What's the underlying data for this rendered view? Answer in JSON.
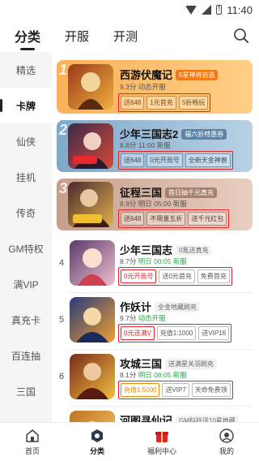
{
  "status": {
    "time": "11:40"
  },
  "top_tabs": [
    {
      "label": "分类",
      "active": true
    },
    {
      "label": "开服",
      "active": false
    },
    {
      "label": "开测",
      "active": false
    }
  ],
  "sidebar": [
    {
      "label": "精选",
      "active": false
    },
    {
      "label": "卡牌",
      "active": true
    },
    {
      "label": "仙侠",
      "active": false
    },
    {
      "label": "挂机",
      "active": false
    },
    {
      "label": "传奇",
      "active": false
    },
    {
      "label": "GM特权",
      "active": false
    },
    {
      "label": "满VIP",
      "active": false
    },
    {
      "label": "真充卡",
      "active": false
    },
    {
      "label": "百连抽",
      "active": false
    },
    {
      "label": "三国",
      "active": false
    }
  ],
  "games": [
    {
      "rank": "1",
      "title": "西游伏魔记",
      "badge": "5星神将自选",
      "score": "9.3分",
      "meta": "动态开服",
      "meta_hl": "",
      "tags": [
        "送648",
        "1元首充",
        "5折畅玩"
      ],
      "thumb_text": "天天30抽",
      "colors": [
        "#9a3a18",
        "#f0b040"
      ],
      "badge_color": "#f07a18"
    },
    {
      "rank": "2",
      "title": "少年三国志2",
      "badge": "福六折特惠券",
      "score": "8.8分",
      "meta": "11:00 新服",
      "meta_hl": "",
      "tags": [
        "送648",
        "0元开局号",
        "全新天金神兽"
      ],
      "thumb_text": "0元开局",
      "colors": [
        "#3a2a4a",
        "#d84a3a"
      ],
      "badge_color": "#5b84a8"
    },
    {
      "rank": "3",
      "title": "征程三国",
      "badge": "首日抽千元真充",
      "score": "8.9分",
      "meta": "明日 05:00 新服",
      "meta_hl": "",
      "tags": [
        "送648",
        "不限量五折",
        "送千元红包"
      ],
      "thumb_text": "免费送",
      "colors": [
        "#4a2a2a",
        "#e0b050"
      ],
      "badge_color": "#a8806e"
    },
    {
      "rank": "4",
      "title": "少年三国志",
      "badge": "0氪送真充",
      "score": "8.7分",
      "meta": "明日 00:05 新服",
      "meta_hl": "",
      "tags": [
        "0元开局号",
        "送0元首充",
        "免费首充"
      ],
      "thumb_text": "",
      "colors": [
        "#5a3a6a",
        "#f0c0d0"
      ],
      "badge_color": "#f2f2f2"
    },
    {
      "rank": "5",
      "title": "作妖计",
      "badge": "全金地藏刷充",
      "score": "9.7分",
      "meta": "动态开服",
      "meta_hl": "",
      "tags": [
        "0元送满V",
        "充值1:1000",
        "送VIP16"
      ],
      "thumb_text": "全金地藏",
      "colors": [
        "#2a3a7a",
        "#f0a030"
      ],
      "badge_color": "#f2f2f2"
    },
    {
      "rank": "6",
      "title": "攻城三国",
      "badge": "送满星关羽刷充",
      "score": "8.1分",
      "meta": "明日 08:05 新服",
      "meta_hl": "",
      "tags": [
        "充值1:5000",
        "送VIP7",
        "天命免费领"
      ],
      "thumb_text": "送满星关羽",
      "colors": [
        "#7a2a1a",
        "#f0c040"
      ],
      "badge_color": "#f2f2f2"
    },
    {
      "rank": "7",
      "title": "河图寻仙记",
      "badge": "GM科技送10星地藏",
      "score": "",
      "meta": "",
      "meta_hl": "",
      "tags": [],
      "thumb_text": "",
      "colors": [
        "#c07020",
        "#f8d070"
      ],
      "badge_color": "#f2f2f2"
    }
  ],
  "bottom_nav": [
    {
      "label": "首页",
      "icon": "home-icon",
      "active": false
    },
    {
      "label": "分类",
      "icon": "category-icon",
      "active": true
    },
    {
      "label": "福利中心",
      "icon": "gift-icon",
      "active": false
    },
    {
      "label": "我的",
      "icon": "profile-icon",
      "active": false
    }
  ],
  "accent": {
    "highlight_border": "#e4232b",
    "green": "#2ea84f"
  }
}
